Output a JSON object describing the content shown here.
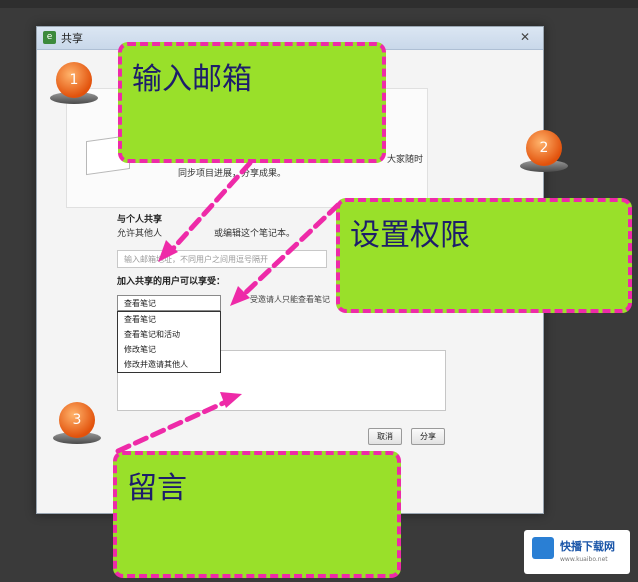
{
  "window": {
    "title": "共享",
    "title_icon": "evernote-icon",
    "close_glyph": "✕"
  },
  "intro": {
    "line_a": "大家随时",
    "line_b": "同步项目进展，分享成果。"
  },
  "share_individual": {
    "title": "与个人共享",
    "desc_left": "允许其他人",
    "desc_right": "或编辑这个笔记本。",
    "email_placeholder": "输入邮箱地址，不同用户之间用逗号隔开"
  },
  "permission": {
    "label": "加入共享的用户可以享受：",
    "selected": "查看笔记",
    "hint": "受邀请人只能查看笔记",
    "options": [
      "查看笔记",
      "查看笔记和活动",
      "修改笔记",
      "修改并邀请其他人"
    ]
  },
  "buttons": {
    "cancel": "取消",
    "share": "分享"
  },
  "annotations": {
    "note1": "输入邮箱",
    "note2": "设置权限",
    "note3": "留言",
    "badge1": "1",
    "badge2": "2",
    "badge3": "3",
    "note_color": "#99e02a",
    "border_color": "#ee2aa8"
  },
  "watermark": {
    "name": "快播下载网",
    "url": "www.kuaibo.net"
  }
}
